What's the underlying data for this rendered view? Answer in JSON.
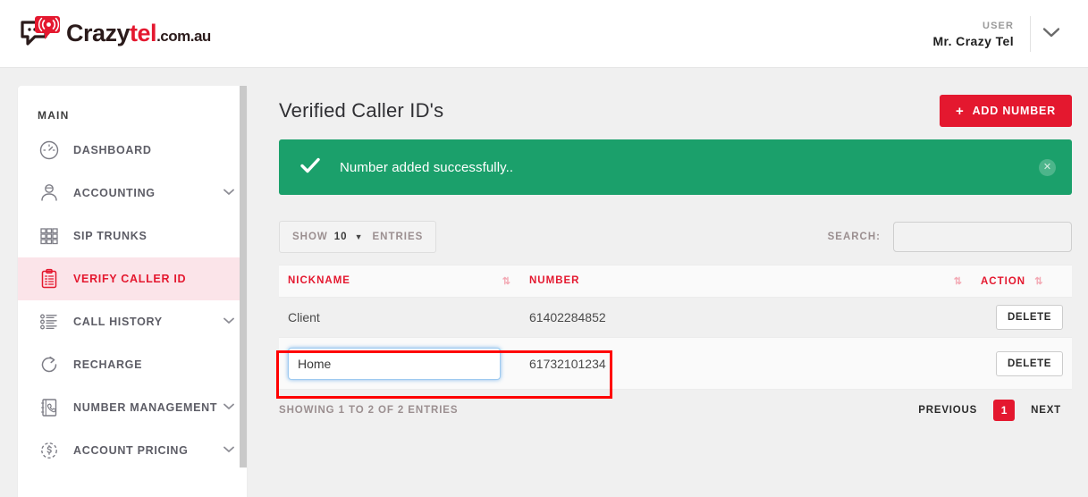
{
  "brand": {
    "name_dark": "Crazy",
    "name_accent": "tel",
    "tld": ".com.au",
    "logo_icon": "speech-bubble-broadcast-icon",
    "accent_color": "#e4182f"
  },
  "topbar": {
    "user_label": "USER",
    "user_name": "Mr. Crazy Tel",
    "caret_icon": "chevron-down-icon"
  },
  "sidebar": {
    "section_title": "MAIN",
    "items": [
      {
        "label": "DASHBOARD",
        "icon": "gauge-icon",
        "has_caret": false,
        "active": false
      },
      {
        "label": "ACCOUNTING",
        "icon": "user-icon",
        "has_caret": true,
        "active": false
      },
      {
        "label": "SIP TRUNKS",
        "icon": "grid-squares-icon",
        "has_caret": false,
        "active": false
      },
      {
        "label": "VERIFY CALLER ID",
        "icon": "clipboard-icon",
        "has_caret": false,
        "active": true
      },
      {
        "label": "CALL HISTORY",
        "icon": "list-icon",
        "has_caret": true,
        "active": false
      },
      {
        "label": "RECHARGE",
        "icon": "refresh-circle-icon",
        "has_caret": false,
        "active": false
      },
      {
        "label": "NUMBER MANAGEMENT",
        "icon": "phonebook-icon",
        "has_caret": true,
        "active": false
      },
      {
        "label": "ACCOUNT PRICING",
        "icon": "dollar-circle-icon",
        "has_caret": true,
        "active": false
      }
    ]
  },
  "page": {
    "title": "Verified Caller ID's",
    "add_button": {
      "label": "ADD NUMBER",
      "icon": "plus-icon"
    }
  },
  "alert": {
    "message": "Number added successfully..",
    "icon": "check-icon",
    "close_icon": "close-icon",
    "color": "#1ba06b"
  },
  "controls": {
    "show_prefix": "SHOW",
    "show_value": "10",
    "show_suffix": "ENTRIES",
    "caret_icon": "caret-down-icon",
    "search_label": "SEARCH:",
    "search_value": "",
    "search_placeholder": ""
  },
  "table": {
    "headers": [
      {
        "label": "NICKNAME",
        "sort_icon": "sort-icon"
      },
      {
        "label": "NUMBER",
        "sort_icon": "sort-icon"
      },
      {
        "label": "ACTION",
        "sort_icon": "sort-icon"
      }
    ],
    "rows": [
      {
        "nickname": "Client",
        "number": "61402284852",
        "action_label": "DELETE",
        "editing": false
      },
      {
        "nickname": "Home",
        "number": "61732101234",
        "action_label": "DELETE",
        "editing": true
      }
    ]
  },
  "footer": {
    "info": "SHOWING 1 TO 2 OF 2 ENTRIES",
    "previous": "PREVIOUS",
    "current_page": "1",
    "next": "NEXT"
  }
}
